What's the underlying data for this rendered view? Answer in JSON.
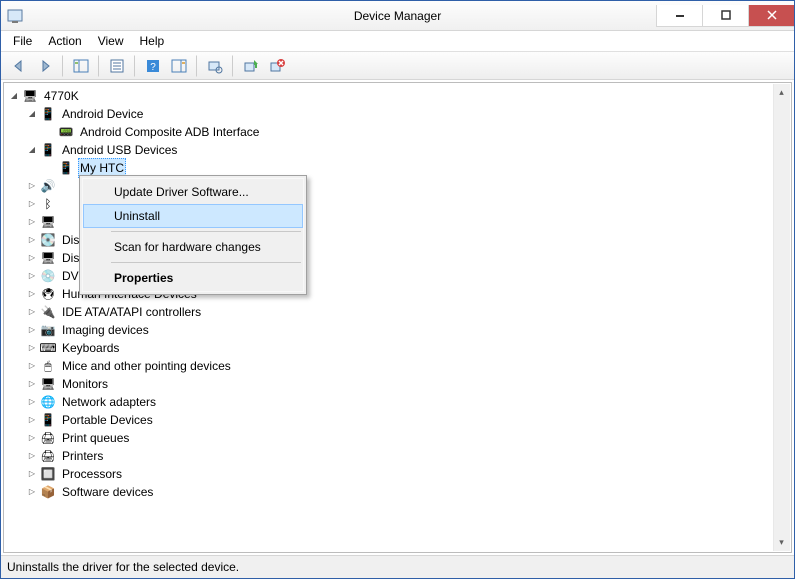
{
  "window": {
    "title": "Device Manager"
  },
  "menubar": [
    "File",
    "Action",
    "View",
    "Help"
  ],
  "tree": {
    "root": "4770K",
    "android_device": {
      "label": "Android Device",
      "children": [
        "Android Composite ADB Interface"
      ]
    },
    "android_usb": {
      "label": "Android USB Devices",
      "selected_child": "My HTC"
    },
    "collapsed_before": [
      "Audio inputs and outputs",
      "Bluetooth",
      "Computer"
    ],
    "collapsed": [
      "Disk drives",
      "Display adapters",
      "DVD/CD-ROM drives",
      "Human Interface Devices",
      "IDE ATA/ATAPI controllers",
      "Imaging devices",
      "Keyboards",
      "Mice and other pointing devices",
      "Monitors",
      "Network adapters",
      "Portable Devices",
      "Print queues",
      "Printers",
      "Processors",
      "Software devices"
    ]
  },
  "context_menu": {
    "update": "Update Driver Software...",
    "uninstall": "Uninstall",
    "scan": "Scan for hardware changes",
    "properties": "Properties"
  },
  "statusbar": "Uninstalls the driver for the selected device.",
  "icons": {
    "computer": "🖥",
    "android": "📱",
    "adb": "📟",
    "usb": "📱",
    "phone": "📱",
    "disk": "💽",
    "display": "🖥",
    "dvd": "💿",
    "hid": "🖲",
    "ide": "🔌",
    "imaging": "📷",
    "keyboard": "⌨",
    "mouse": "🖱",
    "monitor": "🖥",
    "network": "🌐",
    "portable": "📱",
    "printqueue": "🖨",
    "printer": "🖨",
    "processor": "🔲",
    "software": "📦",
    "audio": "🔊",
    "bluetooth": "ᛒ",
    "pc": "🖥"
  }
}
